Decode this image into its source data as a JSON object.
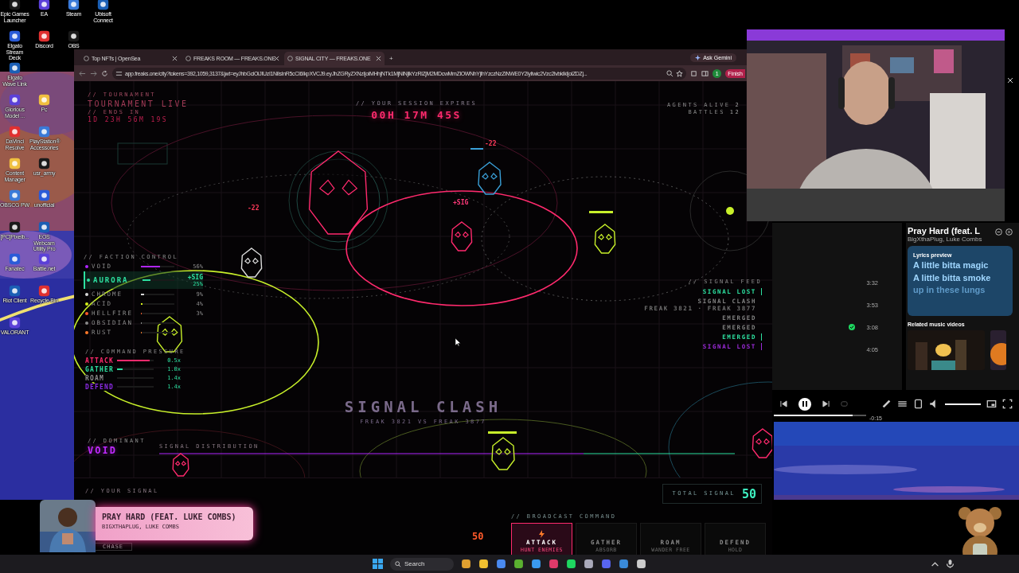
{
  "desktop": {
    "icon_columns": [
      [
        {
          "label": "Epic Games Launcher"
        },
        {
          "label": "Elgato Stream Deck"
        },
        {
          "label": "Elgato Wave Link"
        },
        {
          "label": "Glorious Model ..."
        },
        {
          "label": "DaVinci Resolve"
        },
        {
          "label": "Content Manager"
        },
        {
          "label": "OBSCG PW"
        },
        {
          "label": "[PC]Pixelb..."
        },
        {
          "label": "Fanatec"
        },
        {
          "label": "Riot Client"
        },
        {
          "label": "VALORANT"
        }
      ],
      [
        {
          "label": "EA"
        },
        {
          "label": "Discord"
        },
        {
          "label": "Pc"
        },
        {
          "label": "PlayStation® Accessories"
        },
        {
          "label": "usr_army"
        },
        {
          "label": "unofficial"
        },
        {
          "label": "EOS Webcam Utility Pro"
        },
        {
          "label": "Battle.net"
        },
        {
          "label": "Recycle Bin"
        }
      ],
      [
        {
          "label": "Steam"
        },
        {
          "label": "OBS"
        }
      ],
      [
        {
          "label": "Ubisoft Connect"
        }
      ]
    ]
  },
  "browser": {
    "tabs": [
      {
        "label": "Top NFTs | OpenSea",
        "selected": false
      },
      {
        "label": "FREAKS ROOM — FREAKS.ONE",
        "selected": false
      },
      {
        "label": "SIGNAL CITY — FREAKS.ONE",
        "selected": true
      }
    ],
    "new_tab": "+",
    "ask_gemini": "Ask Gemini",
    "finish": "Finish",
    "address": "app.freaks.one/city?tokens=392,1059,3137&jwt=eyJhbGciOiJIUzI1NiIsInR5cCI6IkpXVCJ9.eyJhZGRyZXNzIjoiMHhjNTk1MjNlNjlkYzRlZjM2MDcwMmZlOWNhYjlhYzczNzZiNWE0Y2Iyliwic2Vzc2lvbklkIjoiZDZj...",
    "profile": "1"
  },
  "game": {
    "tournament": {
      "label": "// TOURNAMENT",
      "status": "TOURNAMENT LIVE",
      "ends_label": "// ENDS IN",
      "ends_in": "1D 23H 56M 19S"
    },
    "session": {
      "label": "// YOUR SESSION EXPIRES",
      "time": "00H 17M 45S"
    },
    "stats": [
      {
        "label": "AGENTS ALIVE",
        "value": "2"
      },
      {
        "label": "BATTLES",
        "value": "12"
      }
    ],
    "floaters": [
      {
        "text": "-22",
        "kind": "damage"
      },
      {
        "text": "-22",
        "kind": "damage"
      },
      {
        "text": "+SIG",
        "kind": "gain"
      }
    ],
    "faction_control": {
      "label": "// FACTION CONTROL",
      "factions": [
        {
          "name": "VOID",
          "color": "#b026ff",
          "level": 0.56,
          "share": "56%",
          "selected": false
        },
        {
          "name": "AURORA",
          "color": "#2de0a0",
          "level": 0.25,
          "share": "25%",
          "gain": "+SIG",
          "selected": true
        },
        {
          "name": "CHROME",
          "color": "#d8d8d8",
          "level": 0.09,
          "share": "9%",
          "selected": false
        },
        {
          "name": "ACID",
          "color": "#d4ef1a",
          "level": 0.04,
          "share": "4%",
          "selected": false
        },
        {
          "name": "HELLFIRE",
          "color": "#ff5a2a",
          "level": 0.03,
          "share": "3%",
          "selected": false
        },
        {
          "name": "OBSIDIAN",
          "color": "#8a8a8a",
          "level": 0.02,
          "selected": false
        },
        {
          "name": "RUST",
          "color": "#ff7a2a",
          "level": 0.01,
          "selected": false
        }
      ]
    },
    "command_pressure": {
      "label": "// COMMAND PRESSURE",
      "rows": [
        {
          "name": "ATTACK",
          "color": "#ff2a6d",
          "level": 0.9,
          "value": "0.5x"
        },
        {
          "name": "GATHER",
          "color": "#2de0a0",
          "level": 0.15,
          "value": "1.0x"
        },
        {
          "name": "ROAM",
          "color": "#8a8a8a",
          "value": "1.4x"
        },
        {
          "name": "DEFEND",
          "color": "#8a2be2",
          "value": "1.4x"
        }
      ]
    },
    "signal_feed": {
      "label": "// SIGNAL FEED",
      "events": [
        {
          "text": "SIGNAL LOST",
          "color": "#2de0a0",
          "marked": true
        },
        {
          "text": "SIGNAL CLASH",
          "detail": "FREAK 3821 · FREAK 3877",
          "color": "#808080",
          "marked": false
        },
        {
          "text": "EMERGED",
          "color": "#808080",
          "marked": false
        },
        {
          "text": "EMERGED",
          "color": "#808080",
          "marked": false
        },
        {
          "text": "EMERGED",
          "color": "#2de0a0",
          "marked": true
        },
        {
          "text": "SIGNAL LOST",
          "color": "#9b2bd8",
          "marked": true
        }
      ]
    },
    "clash": {
      "title": "SIGNAL CLASH",
      "matchup": "FREAK 3821 VS FREAK 3877"
    },
    "dominant": {
      "label": "// DOMINANT",
      "value": "VOID"
    },
    "distribution": {
      "label": "SIGNAL DISTRIBUTION"
    },
    "your_signal": {
      "label": "// YOUR SIGNAL",
      "value": "50",
      "mode": "CHASE"
    },
    "total_signal": {
      "label": "TOTAL SIGNAL",
      "value": "50"
    },
    "broadcast": {
      "label": "// BROADCAST COMMAND",
      "commands": [
        {
          "name": "ATTACK",
          "hint": "HUNT ENEMIES",
          "selected": true
        },
        {
          "name": "GATHER",
          "hint": "ABSORB",
          "selected": false
        },
        {
          "name": "ROAM",
          "hint": "WANDER FREE",
          "selected": false
        },
        {
          "name": "DEFEND",
          "hint": "HOLD",
          "selected": false
        }
      ]
    }
  },
  "song_overlay": {
    "title": "PRAY HARD (FEAT. LUKE COMBS)",
    "artists": "BIGXTHAPLUG, LUKE COMBS"
  },
  "music_panel": {
    "tracks": [
      {
        "duration": "3:32",
        "saved": false
      },
      {
        "duration": "3:53",
        "saved": false
      },
      {
        "duration": "3:08",
        "saved": true
      },
      {
        "duration": "4:05",
        "saved": false
      }
    ],
    "title": "Pray Hard (feat. L",
    "artists": "BigXthaPlug, Luke Combs",
    "lyrics": {
      "label": "Lyrics preview",
      "lines": [
        "A little bitta magic",
        "A little bitta smoke"
      ],
      "next_line": "up in these lungs"
    },
    "related_label": "Related music videos",
    "player": {
      "playing": true,
      "progress": {
        "level": 0.85
      },
      "remaining": "-0:15",
      "volume": {
        "level": 1.0
      }
    }
  },
  "taskbar": {
    "search": {
      "placeholder": "Search"
    }
  }
}
